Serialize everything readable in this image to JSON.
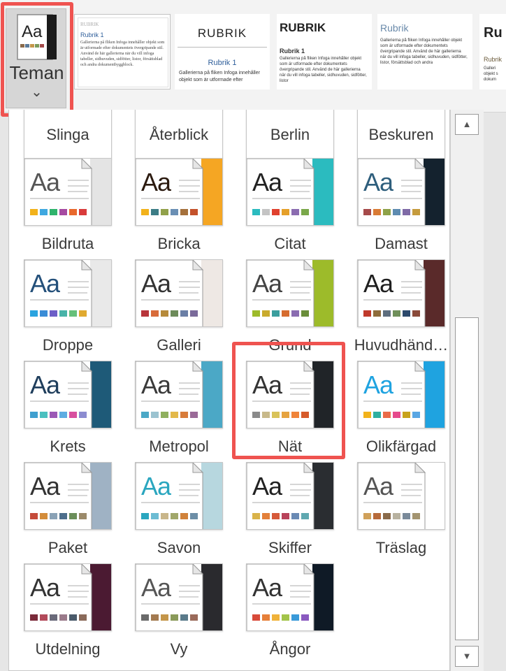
{
  "ribbon": {
    "teman_label": "Teman",
    "teman_chevron": "⌄",
    "style_thumbs": [
      {
        "heading": "RUBRIK",
        "sub": "Rubrik 1",
        "body": "Gallerierna på fliken Infoga innehåller objekt som är utformade efter dokumentets övergripande stil. Använd de här gallerierna när du vill infoga tabeller, sidhuvuden, sidfötter, listor, försättsblad och andra dokumentbyggblock."
      },
      {
        "heading": "RUBRIK",
        "sub": "Rubrik 1",
        "body": "Gallerierna på fliken Infoga innehåller objekt som är utformade efter"
      },
      {
        "heading": "RUBRIK",
        "sub": "Rubrik 1",
        "body": "Gallerierna på fliken Infoga innehåller objekt som är utformade efter dokumentets övergripande stil. Använd de här gallerierna när du vill infoga tabeller, sidhuvuden, sidfötter, listor"
      },
      {
        "heading": "Rubrik",
        "sub": "",
        "body": "Gallerierna på fliken Infoga innehåller objekt som är utformade efter dokumentets övergripande stil. Använd de här gallerierna när du vill infoga tabeller, sidhuvuden, sidfötter, listor, försättsblad och andra"
      },
      {
        "heading": "Ru",
        "sub": "Rubrik",
        "body": "Galleri objekt s dokum"
      }
    ]
  },
  "gallery": {
    "partial_row": [
      "Slinga",
      "Återblick",
      "Berlin",
      "Beskuren"
    ],
    "themes": [
      {
        "name": "Bildruta",
        "aa": "Aa",
        "aa_color": "#555555",
        "side": "#e4e4e4",
        "swatches": [
          "#f2b21b",
          "#3fa8e0",
          "#2fb36c",
          "#a64aa1",
          "#e8682c",
          "#d93b3b"
        ]
      },
      {
        "name": "Bricka",
        "aa": "Aa",
        "aa_color": "#2b1a0f",
        "side": "#f5a623",
        "swatches": [
          "#f2b21b",
          "#3c7d86",
          "#91a14a",
          "#6a8fb4",
          "#a5713c",
          "#c4522b"
        ]
      },
      {
        "name": "Citat",
        "aa": "Aa",
        "aa_color": "#222222",
        "side": "#2bbbbf",
        "swatches": [
          "#2bbbbf",
          "#c4c4c4",
          "#e0412e",
          "#e5a02a",
          "#8b6cb0",
          "#7aa84a"
        ]
      },
      {
        "name": "Damast",
        "aa": "Aa",
        "aa_color": "#2e5e7c",
        "side": "#14222e",
        "swatches": [
          "#a64a4a",
          "#d97b35",
          "#8ea248",
          "#5e8bb0",
          "#7f6aa6",
          "#c59b3d"
        ]
      },
      {
        "name": "Droppe",
        "aa": "Aa",
        "aa_color": "#24507a",
        "side": "#e9e9e9",
        "swatches": [
          "#2aa3df",
          "#3a8cd6",
          "#6c5fc7",
          "#48b3a8",
          "#66c07a",
          "#e0aa30"
        ]
      },
      {
        "name": "Galleri",
        "aa": "Aa",
        "aa_color": "#333333",
        "side": "#eee8e4",
        "swatches": [
          "#b8353b",
          "#d86b3a",
          "#b68a3a",
          "#6d8b5a",
          "#6b7fa6",
          "#7a6a9a"
        ]
      },
      {
        "name": "Grund",
        "aa": "Aa",
        "aa_color": "#444444",
        "side": "#9dbb2a",
        "swatches": [
          "#9dbb2a",
          "#c9ab2d",
          "#3a9e9e",
          "#d66c2f",
          "#8a6cb1",
          "#6a8e3a"
        ]
      },
      {
        "name": "Huvudhänd…",
        "aa": "Aa",
        "aa_color": "#1f1f1f",
        "side": "#5a2a2a",
        "swatches": [
          "#c0392b",
          "#8e6c3a",
          "#5e6e7e",
          "#6f8f5a",
          "#2c4a6c",
          "#8a4a3a"
        ]
      },
      {
        "name": "Krets",
        "aa": "Aa",
        "aa_color": "#1f3e5c",
        "side": "#1e5a78",
        "swatches": [
          "#3f9fcf",
          "#4bc0c0",
          "#9b59b6",
          "#5dade2",
          "#d84f9f",
          "#8c8cd0"
        ]
      },
      {
        "name": "Metropol",
        "aa": "Aa",
        "aa_color": "#3a3a3a",
        "side": "#4ba8c6",
        "swatches": [
          "#4ba8c6",
          "#9bc3d0",
          "#8fb05e",
          "#e3b94a",
          "#d87c3a",
          "#9a6a98"
        ]
      },
      {
        "name": "Nät",
        "aa": "Aa",
        "aa_color": "#333333",
        "side": "#202428",
        "swatches": [
          "#8a8a8a",
          "#c8b98a",
          "#d9c35a",
          "#e6a340",
          "#f0843a",
          "#d65a2a"
        ]
      },
      {
        "name": "Olikfärgad",
        "aa": "Aa",
        "aa_color": "#1fa3e0",
        "side": "#1fa3e0",
        "swatches": [
          "#f2b31b",
          "#2fb0a0",
          "#ea6b48",
          "#e64a8c",
          "#c8a21c",
          "#5aa7e3"
        ]
      },
      {
        "name": "Paket",
        "aa": "Aa",
        "aa_color": "#333333",
        "side": "#9fb2c4",
        "swatches": [
          "#c54b3a",
          "#d38c3a",
          "#8aa2b6",
          "#4d6e8c",
          "#6b8e5a",
          "#9b8a6a"
        ]
      },
      {
        "name": "Savon",
        "aa": "Aa",
        "aa_color": "#2aa6bf",
        "side": "#b7d7df",
        "swatches": [
          "#2aa6bf",
          "#6cbcd3",
          "#c9b68a",
          "#a1a76a",
          "#d0823a",
          "#6d8ea6"
        ]
      },
      {
        "name": "Skiffer",
        "aa": "Aa",
        "aa_color": "#222222",
        "side": "#2a2d31",
        "swatches": [
          "#d9b34a",
          "#e3803a",
          "#d65a3a",
          "#b8435a",
          "#6a8ab4",
          "#5fa8b0"
        ]
      },
      {
        "name": "Träslag",
        "aa": "Aa",
        "aa_color": "#555555",
        "side": "#ffffff",
        "swatches": [
          "#d0a15a",
          "#b76a3a",
          "#8a6a4a",
          "#b8b2a0",
          "#7a8a9a",
          "#a39470"
        ]
      },
      {
        "name": "Utdelning",
        "aa": "Aa",
        "aa_color": "#333333",
        "side": "#4b1a32",
        "swatches": [
          "#7a2a3a",
          "#b24a5a",
          "#6a6a7a",
          "#9a7a8a",
          "#4a5a6a",
          "#8a6a5a"
        ]
      },
      {
        "name": "Vy",
        "aa": "Aa",
        "aa_color": "#555555",
        "side": "#2a2a2e",
        "swatches": [
          "#6a6a6a",
          "#a37a50",
          "#c4964a",
          "#8a9a5a",
          "#5a7a8a",
          "#9a6a5a"
        ]
      },
      {
        "name": "Ångor",
        "aa": "Aa",
        "aa_color": "#333333",
        "side": "#0f1a26",
        "swatches": [
          "#d84a3a",
          "#e6803a",
          "#f0b23a",
          "#a3c44a",
          "#3a9ad9",
          "#8a5ac0"
        ]
      }
    ]
  },
  "scrollbar": {
    "up": "▲",
    "down": "▼"
  },
  "colors": {
    "highlight": "#ef5350"
  }
}
